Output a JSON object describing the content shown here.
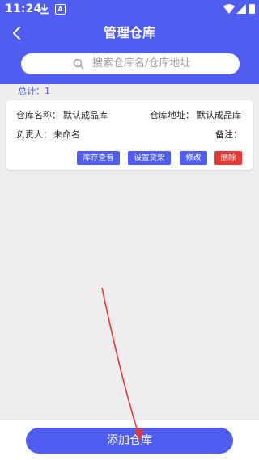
{
  "status_bar": {
    "time": "11:24",
    "badge": "A"
  },
  "header": {
    "title": "管理仓库"
  },
  "search": {
    "placeholder": "搜索仓库名/仓库地址"
  },
  "total": {
    "text": "总计：1"
  },
  "warehouses": [
    {
      "name_label": "仓库名称：",
      "name": "默认成品库",
      "address_label": "仓库地址：",
      "address": "默认成品库",
      "manager_label": "负责人：",
      "manager": "未命名",
      "remark_label": "备注：",
      "actions": {
        "view": "库存查看",
        "shelf": "设置货架",
        "edit": "修改",
        "delete": "删除"
      }
    }
  ],
  "footer": {
    "add_label": "添加仓库"
  },
  "colors": {
    "primary": "#4f5df0",
    "danger": "#e53935",
    "background": "#eeeeee",
    "annotation": "#e53935"
  },
  "icons": [
    "download-icon",
    "a-badge-icon",
    "wifi-icon",
    "signal-icon",
    "battery-icon",
    "back-arrow-icon",
    "search-icon",
    "annotation-arrow"
  ]
}
